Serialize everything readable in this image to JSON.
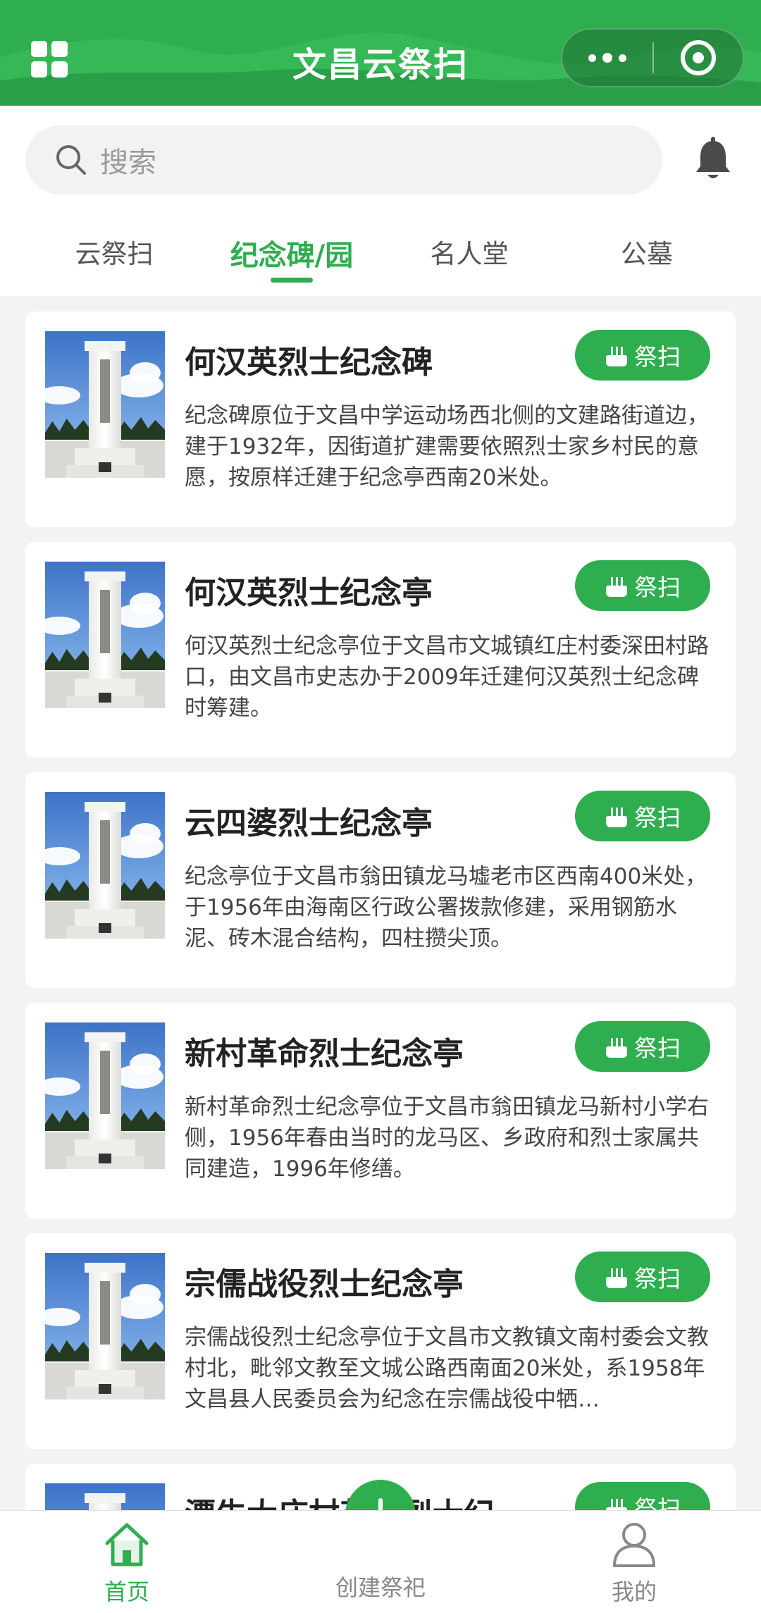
{
  "header": {
    "title": "文昌云祭扫"
  },
  "search": {
    "placeholder": "搜索"
  },
  "tabs": [
    {
      "label": "云祭扫",
      "active": false
    },
    {
      "label": "纪念碑/园",
      "active": true
    },
    {
      "label": "名人堂",
      "active": false
    },
    {
      "label": "公墓",
      "active": false
    }
  ],
  "cards": [
    {
      "title": "何汉英烈士纪念碑",
      "desc": "纪念碑原位于文昌中学运动场西北侧的文建路街道边，建于1932年，因街道扩建需要依照烈士家乡村民的意愿，按原样迁建于纪念亭西南20米处。",
      "button": "祭扫"
    },
    {
      "title": "何汉英烈士纪念亭",
      "desc": "何汉英烈士纪念亭位于文昌市文城镇红庄村委深田村路口，由文昌市史志办于2009年迁建何汉英烈士纪念碑时筹建。",
      "button": "祭扫"
    },
    {
      "title": "云四婆烈士纪念亭",
      "desc": "纪念亭位于文昌市翁田镇龙马墟老市区西南400米处，于1956年由海南区行政公署拨款修建，采用钢筋水泥、砖木混合结构，四柱攒尖顶。",
      "button": "祭扫"
    },
    {
      "title": "新村革命烈士纪念亭",
      "desc": "新村革命烈士纪念亭位于文昌市翁田镇龙马新村小学右侧，1956年春由当时的龙马区、乡政府和烈士家属共同建造，1996年修缮。",
      "button": "祭扫"
    },
    {
      "title": "宗儒战役烈士纪念亭",
      "desc": "宗儒战役烈士纪念亭位于文昌市文教镇文南村委会文教村北，毗邻文教至文城公路西南面20米处，系1958年文昌县人民委员会为纪念在宗儒战役中牺…",
      "button": "祭扫"
    },
    {
      "title": "潭牛大庙村革命烈士纪",
      "desc": "",
      "button": "祭扫"
    }
  ],
  "bottom_nav": {
    "home": "首页",
    "create": "创建祭祀",
    "mine": "我的"
  },
  "colors": {
    "accent": "#2fae4f"
  },
  "icons": [
    "grid-menu-icon",
    "more-dots-icon",
    "target-icon",
    "search-icon",
    "bell-icon",
    "incense-icon",
    "home-icon",
    "plus-icon",
    "user-icon"
  ]
}
